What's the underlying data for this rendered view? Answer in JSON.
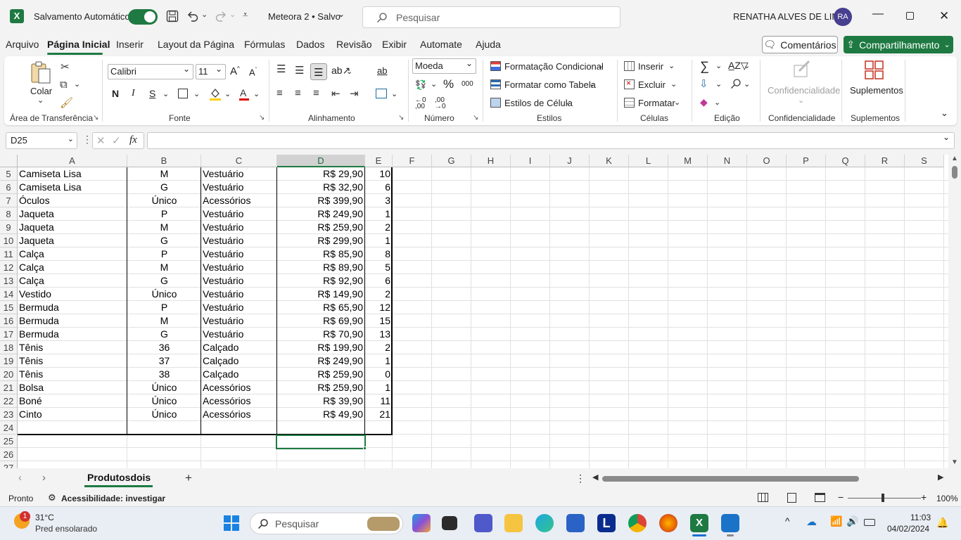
{
  "titlebar": {
    "autosave_label": "Salvamento Automático",
    "file_title": "Meteora 2 • Salvo",
    "search_placeholder": "Pesquisar",
    "user_name": "RENATHA ALVES DE LIMA",
    "user_initials": "RA"
  },
  "menu": {
    "items": [
      "Arquivo",
      "Página Inicial",
      "Inserir",
      "Layout da Página",
      "Fórmulas",
      "Dados",
      "Revisão",
      "Exibir",
      "Automate",
      "Ajuda"
    ],
    "active": "Página Inicial",
    "comments_label": "Comentários",
    "share_label": "Compartilhamento"
  },
  "ribbon": {
    "clipboard": {
      "paste_label": "Colar",
      "group_label": "Área de Transferência"
    },
    "font": {
      "family": "Calibri",
      "size": "11",
      "group_label": "Fonte",
      "bold": "N",
      "italic": "I",
      "underline": "S"
    },
    "alignment": {
      "group_label": "Alinhamento"
    },
    "number": {
      "format": "Moeda",
      "group_label": "Número",
      "percent": "%",
      "thousands": "000",
      "inc_dec": "←0\n,00",
      "dec_dec": ",00\n→0"
    },
    "styles": {
      "conditional": "Formatação Condicional",
      "as_table": "Formatar como Tabela",
      "cell_styles": "Estilos de Célula",
      "group_label": "Estilos"
    },
    "cells": {
      "insert": "Inserir",
      "delete": "Excluir",
      "format": "Formatar",
      "group_label": "Células"
    },
    "editing": {
      "group_label": "Edição"
    },
    "sensitivity": {
      "label": "Confidencialidade",
      "group_label": "Confidencialidade"
    },
    "addins": {
      "label": "Suplementos",
      "group_label": "Suplementos"
    }
  },
  "formula_bar": {
    "name_box": "D25",
    "fx": "fx",
    "content": ""
  },
  "grid": {
    "columns": [
      "A",
      "B",
      "C",
      "D",
      "E",
      "F",
      "G",
      "H",
      "I",
      "J",
      "K",
      "L",
      "M",
      "N",
      "O",
      "P",
      "Q",
      "R",
      "S"
    ],
    "selected_column": "D",
    "row_numbers": [
      "5",
      "6",
      "7",
      "8",
      "9",
      "10",
      "11",
      "12",
      "13",
      "14",
      "15",
      "16",
      "17",
      "18",
      "19",
      "20",
      "21",
      "22",
      "23",
      "24",
      "25",
      "26",
      "27"
    ],
    "rows": [
      [
        "Camiseta Lisa",
        "M",
        "Vestuário",
        "R$ 29,90",
        "10"
      ],
      [
        "Camiseta Lisa",
        "G",
        "Vestuário",
        "R$ 32,90",
        "6"
      ],
      [
        "Óculos",
        "Único",
        "Acessórios",
        "R$ 399,90",
        "3"
      ],
      [
        "Jaqueta",
        "P",
        "Vestuário",
        "R$ 249,90",
        "1"
      ],
      [
        "Jaqueta",
        "M",
        "Vestuário",
        "R$ 259,90",
        "2"
      ],
      [
        "Jaqueta",
        "G",
        "Vestuário",
        "R$ 299,90",
        "1"
      ],
      [
        "Calça",
        "P",
        "Vestuário",
        "R$ 85,90",
        "8"
      ],
      [
        "Calça",
        "M",
        "Vestuário",
        "R$ 89,90",
        "5"
      ],
      [
        "Calça",
        "G",
        "Vestuário",
        "R$ 92,90",
        "6"
      ],
      [
        "Vestido",
        "Único",
        "Vestuário",
        "R$ 149,90",
        "2"
      ],
      [
        "Bermuda",
        "P",
        "Vestuário",
        "R$ 65,90",
        "12"
      ],
      [
        "Bermuda",
        "M",
        "Vestuário",
        "R$ 69,90",
        "15"
      ],
      [
        "Bermuda",
        "G",
        "Vestuário",
        "R$ 70,90",
        "13"
      ],
      [
        "Tênis",
        "36",
        "Calçado",
        "R$ 199,90",
        "2"
      ],
      [
        "Tênis",
        "37",
        "Calçado",
        "R$ 249,90",
        "1"
      ],
      [
        "Tênis",
        "38",
        "Calçado",
        "R$ 259,90",
        "0"
      ],
      [
        "Bolsa",
        "Único",
        "Acessórios",
        "R$ 259,90",
        "1"
      ],
      [
        "Boné",
        "Único",
        "Acessórios",
        "R$ 39,90",
        "11"
      ],
      [
        "Cinto",
        "Único",
        "Acessórios",
        "R$ 49,90",
        "21"
      ]
    ]
  },
  "sheets": {
    "tabs": [
      "Produtosdois"
    ],
    "active": "Produtosdois",
    "add": "+"
  },
  "status": {
    "ready": "Pronto",
    "accessibility": "Acessibilidade: investigar",
    "zoom": "100%"
  },
  "taskbar": {
    "weather_temp": "31°C",
    "weather_desc": "Pred ensolarado",
    "notification_count": "1",
    "search_placeholder": "Pesquisar",
    "time": "11:03",
    "date": "04/02/2024"
  },
  "colors": {
    "accent": "#1e7a42",
    "selection": "#1e7a42"
  }
}
